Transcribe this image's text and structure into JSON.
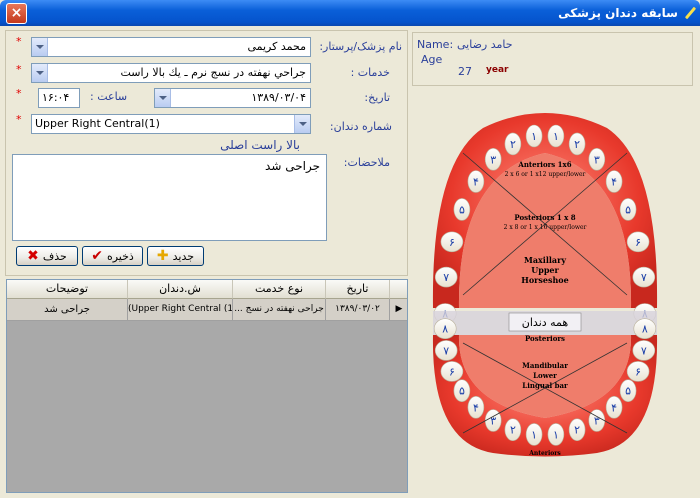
{
  "window": {
    "title": "سابقه دندان پزشکی",
    "close": "×"
  },
  "patient": {
    "name_label": "Name:",
    "name_value": "حامد رضایی",
    "age_label": "Age",
    "age_value": "27",
    "age_unit": "year"
  },
  "form": {
    "doctor_label": "نام پزشک/پرستار:",
    "doctor_value": "محمد کریمی",
    "service_label": "خدمات :",
    "service_value": "جراحي نهفته در نسج نرم ـ يك بالا راست",
    "date_label": "تاریخ:",
    "date_value": "۱۳۸۹/۰۳/۰۴",
    "time_label": "ساعت :",
    "time_value": "۱۶:۰۴",
    "tooth_label": "شماره دندان:",
    "tooth_value": "Upper Right Central(1)",
    "tooth_desc": "بالا راست اصلی",
    "notes_label": "ملاحضات:",
    "notes_value": "جراحی شد",
    "required_mark": "*"
  },
  "buttons": {
    "new": "جدید",
    "save": "ذخیره",
    "delete": "حذف"
  },
  "table": {
    "columns": [
      "تاریخ",
      "نوع خدمت",
      "ش.دندان",
      "توضیحات"
    ],
    "rows": [
      {
        "date": "۱۳۸۹/۰۳/۰۲",
        "service": "جراحی نهفته در نسج ...",
        "tooth": "(Upper Right Central (1",
        "notes": "جراحی شد"
      }
    ]
  },
  "chart": {
    "upper_numbers": [
      "1",
      "1",
      "2",
      "2",
      "3",
      "3",
      "4",
      "4",
      "5",
      "5",
      "6",
      "6",
      "7",
      "7",
      "8",
      "8"
    ],
    "lower_numbers": [
      "1",
      "1",
      "2",
      "2",
      "3",
      "3",
      "4",
      "4",
      "5",
      "5",
      "6",
      "6",
      "7",
      "7",
      "8",
      "8"
    ],
    "upper_labels": {
      "anteriors": "Anteriors 1x6",
      "anteriors_sub": "2 x 6 or 1 x12 upper/lower",
      "posteriors": "Posteriors 1 x 8",
      "posteriors_sub": "2 x 8 or 1 x 16 upper/lower",
      "maxillary": "Maxillary",
      "upper": "Upper",
      "horseshoe": "Horseshoe"
    },
    "all_teeth_button": "همه دندان",
    "lower_labels": {
      "posteriors": "Posteriors",
      "mandibular": "Mandibular",
      "lower": "Lower",
      "lingual": "Lingual bar",
      "anteriors": "Anteriors"
    }
  },
  "colors": {
    "titlebar": "#0553cc",
    "label": "#2a3f9a",
    "required": "#e00000",
    "gum": "#e8392c"
  }
}
